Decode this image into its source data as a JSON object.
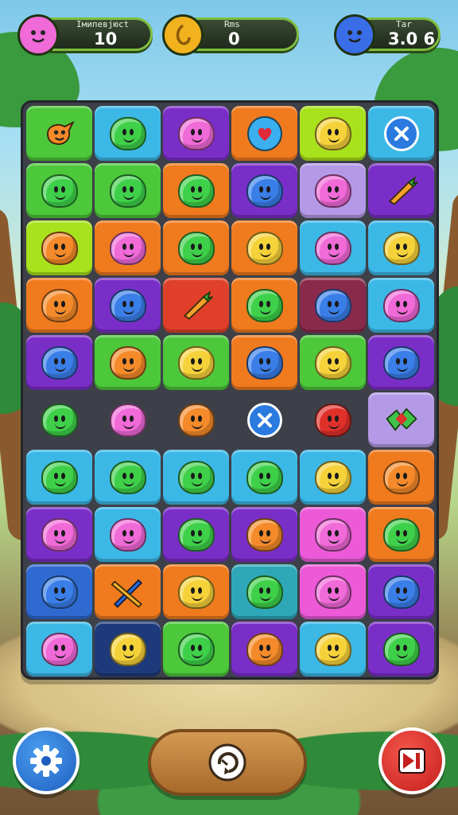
{
  "hud": {
    "left": {
      "label": "Iмипевјюсt",
      "value": "10",
      "avatar": "pink-blob-avatar"
    },
    "center": {
      "label": "Rms",
      "value": "0",
      "avatar": "gold-coin-icon"
    },
    "right": {
      "label": "Tar",
      "value": "3.0 6",
      "avatar": "blue-blob-avatar"
    }
  },
  "colors": {
    "green": "#4cc83a",
    "cyan": "#3cb8e6",
    "purple": "#7a2ec8",
    "orange": "#f07a1e",
    "lime": "#a8e21c",
    "violet": "#8e5ad8",
    "red": "#e0402a",
    "maroon": "#8a2a4a",
    "blue": "#2e6ad0",
    "pink": "#ec5ad8",
    "navy": "#1e3a7a",
    "dark": "#3d4048",
    "lilac": "#b49ae6",
    "teal": "#2ea8b8"
  },
  "board": {
    "rows": [
      [
        {
          "bg": "green",
          "piece": "orange-carrot"
        },
        {
          "bg": "cyan",
          "piece": "green"
        },
        {
          "bg": "purple",
          "piece": "pink"
        },
        {
          "bg": "orange",
          "piece": "heart-special"
        },
        {
          "bg": "lime",
          "piece": "yellow"
        },
        {
          "bg": "cyan",
          "piece": "x-special"
        }
      ],
      [
        {
          "bg": "green",
          "piece": "green"
        },
        {
          "bg": "green",
          "piece": "green"
        },
        {
          "bg": "orange",
          "piece": "green"
        },
        {
          "bg": "purple",
          "piece": "blue"
        },
        {
          "bg": "lilac",
          "piece": "pink"
        },
        {
          "bg": "purple",
          "piece": "carrot-special"
        }
      ],
      [
        {
          "bg": "lime",
          "piece": "orange"
        },
        {
          "bg": "orange",
          "piece": "pink"
        },
        {
          "bg": "orange",
          "piece": "green"
        },
        {
          "bg": "orange",
          "piece": "yellow"
        },
        {
          "bg": "cyan",
          "piece": "pink"
        },
        {
          "bg": "cyan",
          "piece": "yellow"
        }
      ],
      [
        {
          "bg": "orange",
          "piece": "orange"
        },
        {
          "bg": "purple",
          "piece": "blue"
        },
        {
          "bg": "red",
          "piece": "carrot-special"
        },
        {
          "bg": "orange",
          "piece": "green"
        },
        {
          "bg": "maroon",
          "piece": "blue"
        },
        {
          "bg": "cyan",
          "piece": "pink"
        }
      ],
      [
        {
          "bg": "purple",
          "piece": "blue"
        },
        {
          "bg": "green",
          "piece": "orange"
        },
        {
          "bg": "green",
          "piece": "yellow"
        },
        {
          "bg": "orange",
          "piece": "blue"
        },
        {
          "bg": "green",
          "piece": "yellow"
        },
        {
          "bg": "purple",
          "piece": "blue"
        }
      ],
      [
        {
          "bg": "dark",
          "piece": "green"
        },
        {
          "bg": "dark",
          "piece": "pink"
        },
        {
          "bg": "dark",
          "piece": "orange"
        },
        {
          "bg": "dark",
          "piece": "x-special"
        },
        {
          "bg": "dark",
          "piece": "red"
        },
        {
          "bg": "lilac",
          "piece": "gem-special"
        }
      ],
      [
        {
          "bg": "cyan",
          "piece": "green"
        },
        {
          "bg": "cyan",
          "piece": "green"
        },
        {
          "bg": "cyan",
          "piece": "green"
        },
        {
          "bg": "cyan",
          "piece": "green"
        },
        {
          "bg": "cyan",
          "piece": "yellow"
        },
        {
          "bg": "orange",
          "piece": "orange"
        }
      ],
      [
        {
          "bg": "purple",
          "piece": "pink"
        },
        {
          "bg": "cyan",
          "piece": "pink"
        },
        {
          "bg": "purple",
          "piece": "green"
        },
        {
          "bg": "purple",
          "piece": "orange"
        },
        {
          "bg": "pink",
          "piece": "pink"
        },
        {
          "bg": "orange",
          "piece": "green"
        }
      ],
      [
        {
          "bg": "blue",
          "piece": "blue"
        },
        {
          "bg": "orange",
          "piece": "cross-special"
        },
        {
          "bg": "orange",
          "piece": "yellow"
        },
        {
          "bg": "teal",
          "piece": "green"
        },
        {
          "bg": "pink",
          "piece": "pink"
        },
        {
          "bg": "purple",
          "piece": "blue"
        }
      ],
      [
        {
          "bg": "cyan",
          "piece": "pink"
        },
        {
          "bg": "navy",
          "piece": "yellow"
        },
        {
          "bg": "green",
          "piece": "green"
        },
        {
          "bg": "purple",
          "piece": "orange"
        },
        {
          "bg": "cyan",
          "piece": "yellow"
        },
        {
          "bg": "purple",
          "piece": "green"
        }
      ]
    ]
  },
  "pieceColors": {
    "green": "#3fd04a",
    "pink": "#f06ad8",
    "orange": "#f48a2a",
    "yellow": "#f6d23a",
    "blue": "#3a7ee8",
    "red": "#e0302a"
  },
  "footer": {
    "settings_icon": "gear-icon",
    "shuffle_icon": "shuffle-refresh-icon",
    "skip_icon": "skip-forward-icon"
  }
}
